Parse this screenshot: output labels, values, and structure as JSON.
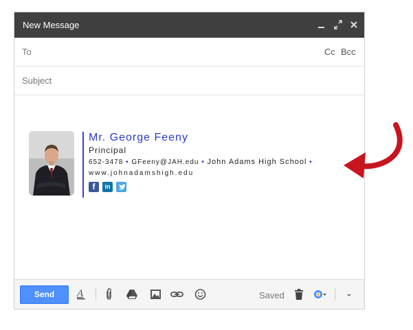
{
  "window": {
    "title": "New Message"
  },
  "compose": {
    "to_label": "To",
    "cc_label": "Cc",
    "bcc_label": "Bcc",
    "subject_placeholder": "Subject"
  },
  "signature": {
    "name": "Mr. George Feeny",
    "title": "Principal",
    "phone": "652-3478",
    "email": "GFeeny@JAH.edu",
    "school": "John Adams High School",
    "website": "www.johnadamshigh.edu",
    "social": [
      "f",
      "in",
      "t"
    ],
    "accent_color": "#3b3fc4",
    "name_color": "#2b39c9"
  },
  "toolbar": {
    "send_label": "Send",
    "saved_label": "Saved",
    "icons": [
      "format-text-icon",
      "attach-icon",
      "drive-icon",
      "photo-icon",
      "link-icon",
      "emoji-icon",
      "trash-icon",
      "more-options-icon",
      "dropdown-arrow-icon"
    ]
  },
  "annotation": {
    "arrow_color": "#c8141e"
  },
  "colors": {
    "titlebar": "#404040",
    "send_button": "#4d90fe"
  }
}
